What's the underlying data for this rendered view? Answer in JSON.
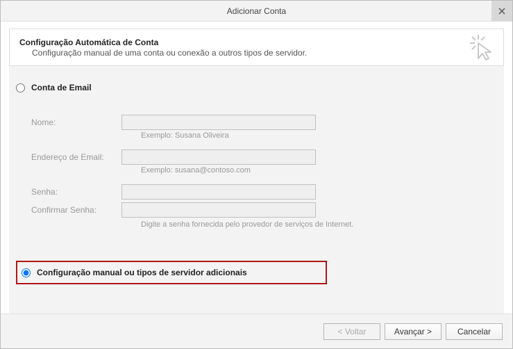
{
  "window": {
    "title": "Adicionar Conta"
  },
  "header": {
    "title": "Configuração Automática de Conta",
    "subtitle": "Configuração manual de uma conta ou conexão a outros tipos de servidor."
  },
  "radios": {
    "email_account": "Conta de Email",
    "manual": "Configuração manual ou tipos de servidor adicionais",
    "selected": "manual"
  },
  "fields": {
    "name_label": "Nome:",
    "name_hint": "Exemplo: Susana Oliveira",
    "email_label": "Endereço de Email:",
    "email_hint": "Exemplo: susana@contoso.com",
    "password_label": "Senha:",
    "confirm_label": "Confirmar Senha:",
    "password_info": "Digite a senha fornecida pelo provedor de serviços de Internet."
  },
  "footer": {
    "back": "< Voltar",
    "next": "Avançar >",
    "cancel": "Cancelar"
  }
}
